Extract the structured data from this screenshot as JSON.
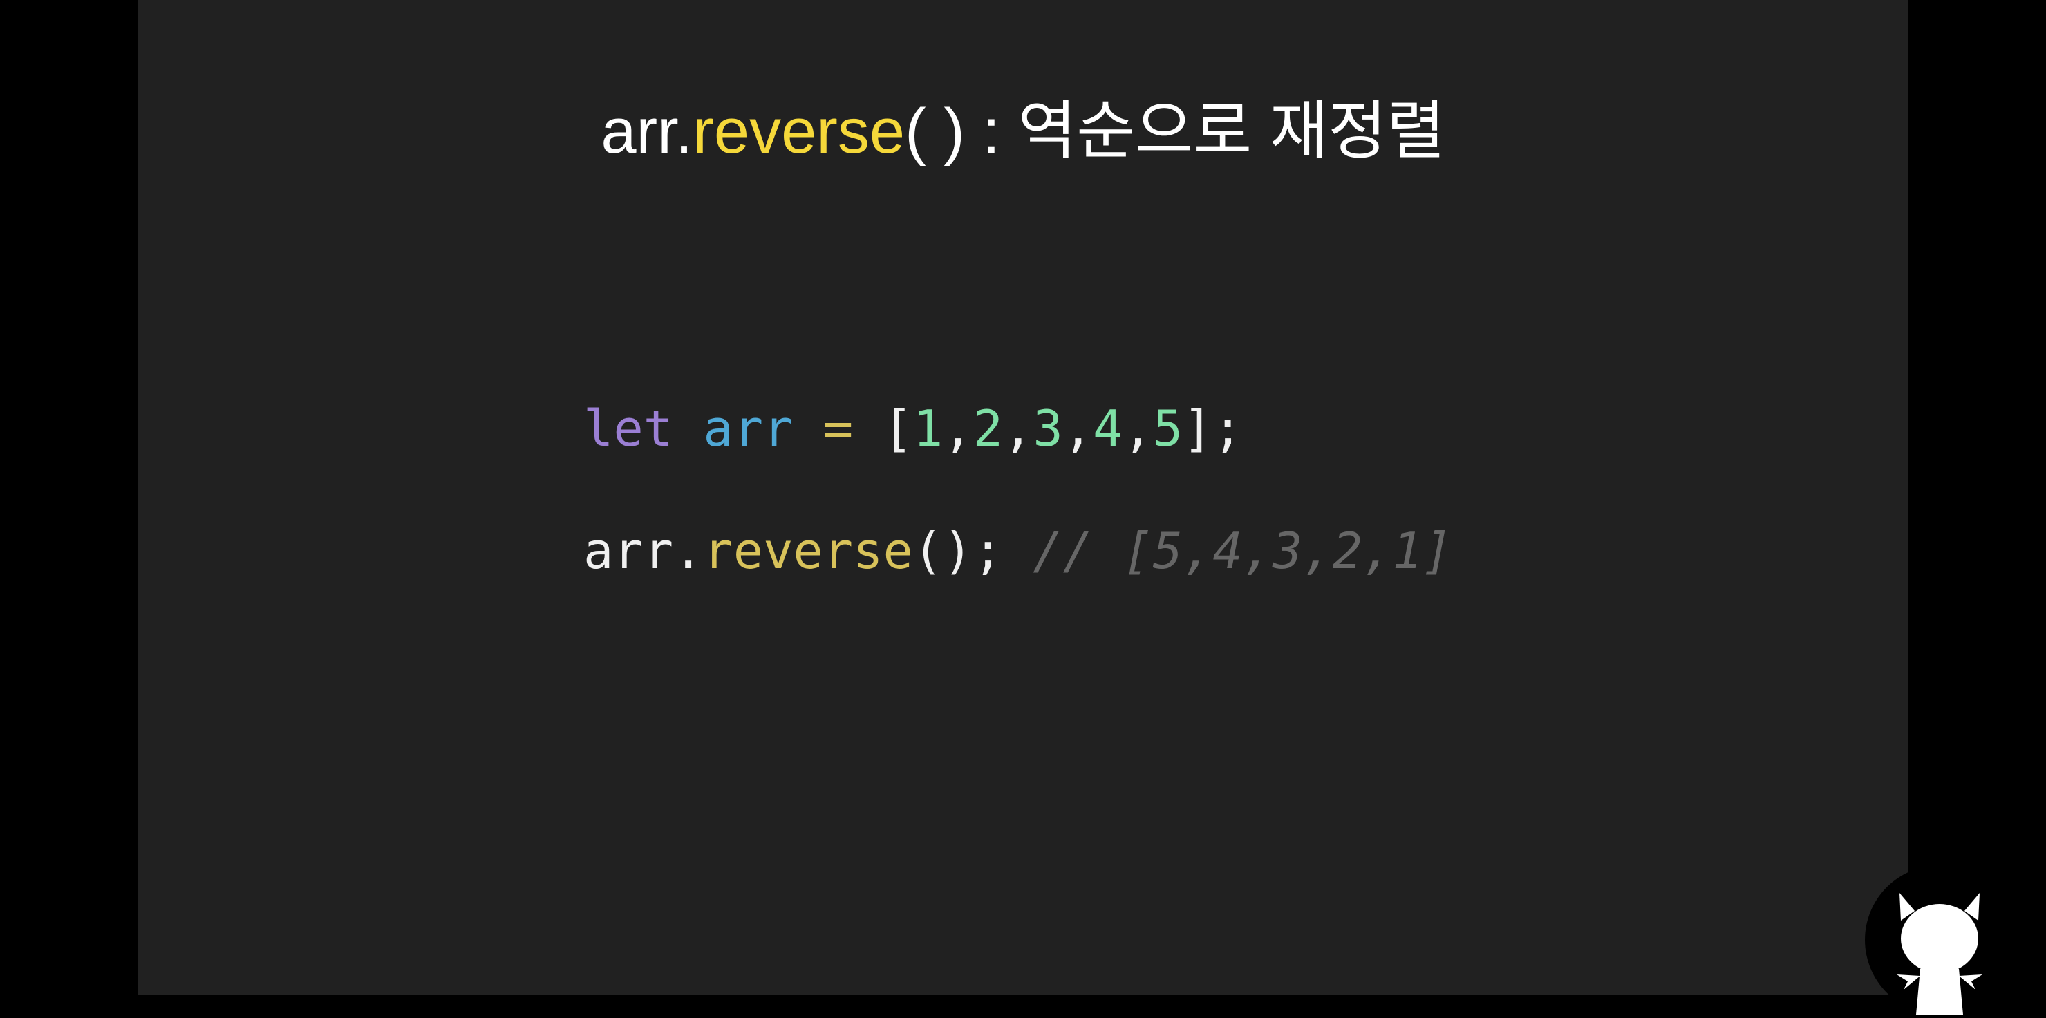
{
  "title": {
    "obj": "arr.",
    "method": "reverse",
    "rest": "( ) : 역순으로 재정렬"
  },
  "code": {
    "line1": {
      "kw": "let",
      "var": "arr",
      "op": "=",
      "open": "[",
      "nums": [
        "1",
        "2",
        "3",
        "4",
        "5"
      ],
      "close": "];"
    },
    "line2": {
      "obj": "arr.",
      "fn": "reverse",
      "rest": "();",
      "comment": "// [5,4,3,2,1]"
    }
  },
  "colors": {
    "background": "#212121",
    "highlight": "#f5d83a"
  },
  "logo": {
    "icon": "devil-cat-icon"
  }
}
